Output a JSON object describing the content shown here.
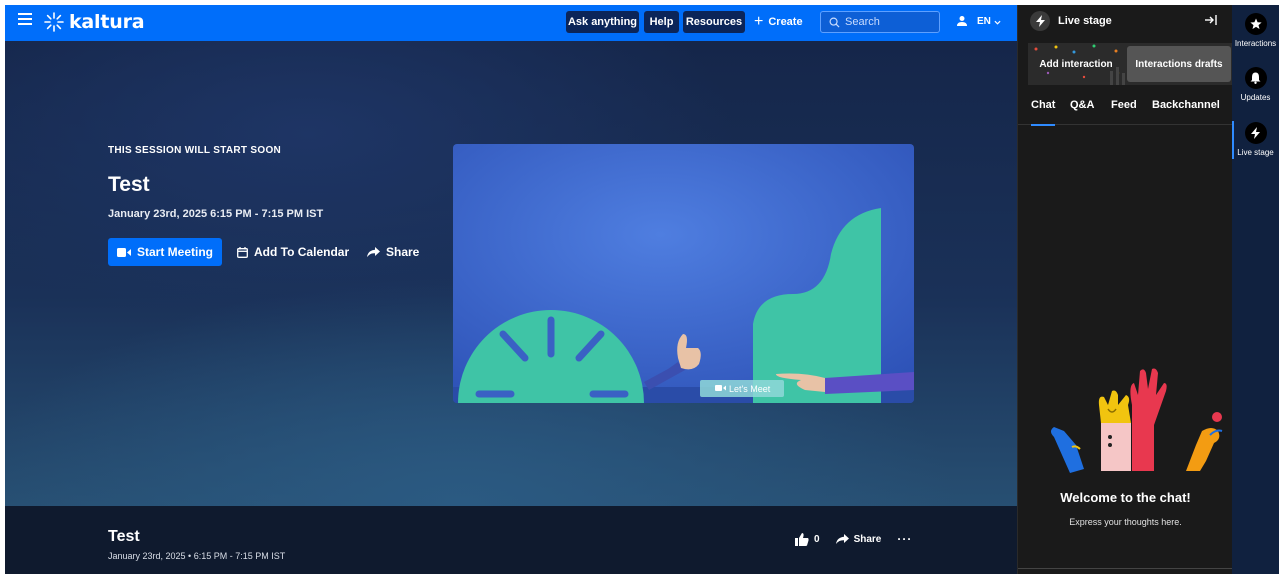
{
  "header": {
    "brand": "kaltura",
    "ask_anything": "Ask anything",
    "help": "Help",
    "resources": "Resources",
    "create": "Create",
    "search_placeholder": "Search",
    "language": "EN",
    "accent_color": "#006efa"
  },
  "hero": {
    "eyebrow": "THIS SESSION WILL START SOON",
    "title": "Test",
    "date": "January 23rd, 2025  6:15 PM - 7:15 PM IST",
    "start_meeting": "Start Meeting",
    "add_to_calendar": "Add To Calendar",
    "share": "Share",
    "preview_button": "Let's Meet"
  },
  "infobar": {
    "title": "Test",
    "date": "January 23rd, 2025  •  6:15 PM - 7:15 PM IST",
    "likes": "0",
    "share": "Share",
    "more": "···"
  },
  "panel": {
    "title": "Live stage",
    "add_interaction": "Add interaction",
    "interactions_drafts": "Interactions drafts",
    "tabs": [
      "Chat",
      "Q&A",
      "Feed",
      "Backchannel"
    ],
    "welcome_title": "Welcome to the chat!",
    "welcome_subtitle": "Express your thoughts here."
  },
  "rail": {
    "items": [
      {
        "label": "Interactions",
        "icon": "star-icon"
      },
      {
        "label": "Updates",
        "icon": "bell-icon"
      },
      {
        "label": "Live stage",
        "icon": "bolt-icon"
      }
    ]
  }
}
